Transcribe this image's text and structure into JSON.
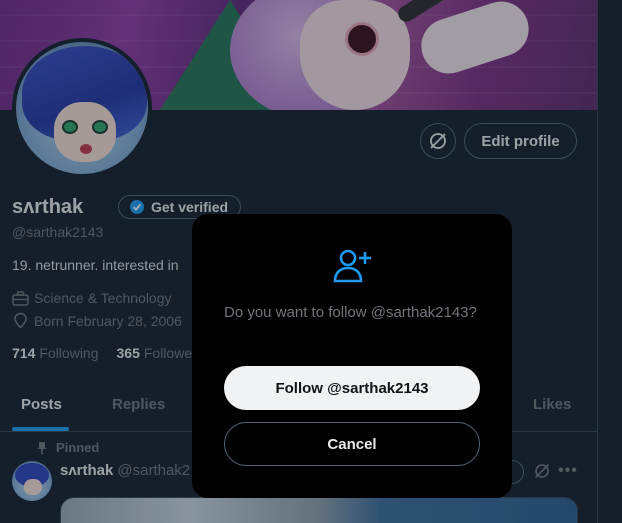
{
  "profile": {
    "name": "sʌrthak",
    "handle": "@sarthak2143",
    "verify_label": "Get verified",
    "edit_label": "Edit profile",
    "bio": "19. netrunner. interested in",
    "category": "Science & Technology",
    "born": "Born February 28, 2006",
    "following_count": "714",
    "following_label": "Following",
    "followers_count": "365",
    "followers_label": "Followers"
  },
  "tabs": [
    {
      "label": "Posts",
      "active": true
    },
    {
      "label": "Replies",
      "active": false
    },
    {
      "label": "Likes",
      "active": false
    }
  ],
  "pinned_post": {
    "pinned_label": "Pinned",
    "name": "sʌrthak",
    "handle": "@sarthak2"
  },
  "modal": {
    "message": "Do you want to follow @sarthak2143?",
    "follow_label": "Follow @sarthak2143",
    "cancel_label": "Cancel"
  },
  "colors": {
    "background": "#15202b",
    "accent": "#1d9bf0",
    "modal_bg": "#000000",
    "muted_text": "#71767b"
  },
  "icons": [
    "unfollow-circle-icon",
    "verified-badge-icon",
    "briefcase-icon",
    "location-pin-icon",
    "pin-icon",
    "more-icon",
    "add-user-icon"
  ]
}
